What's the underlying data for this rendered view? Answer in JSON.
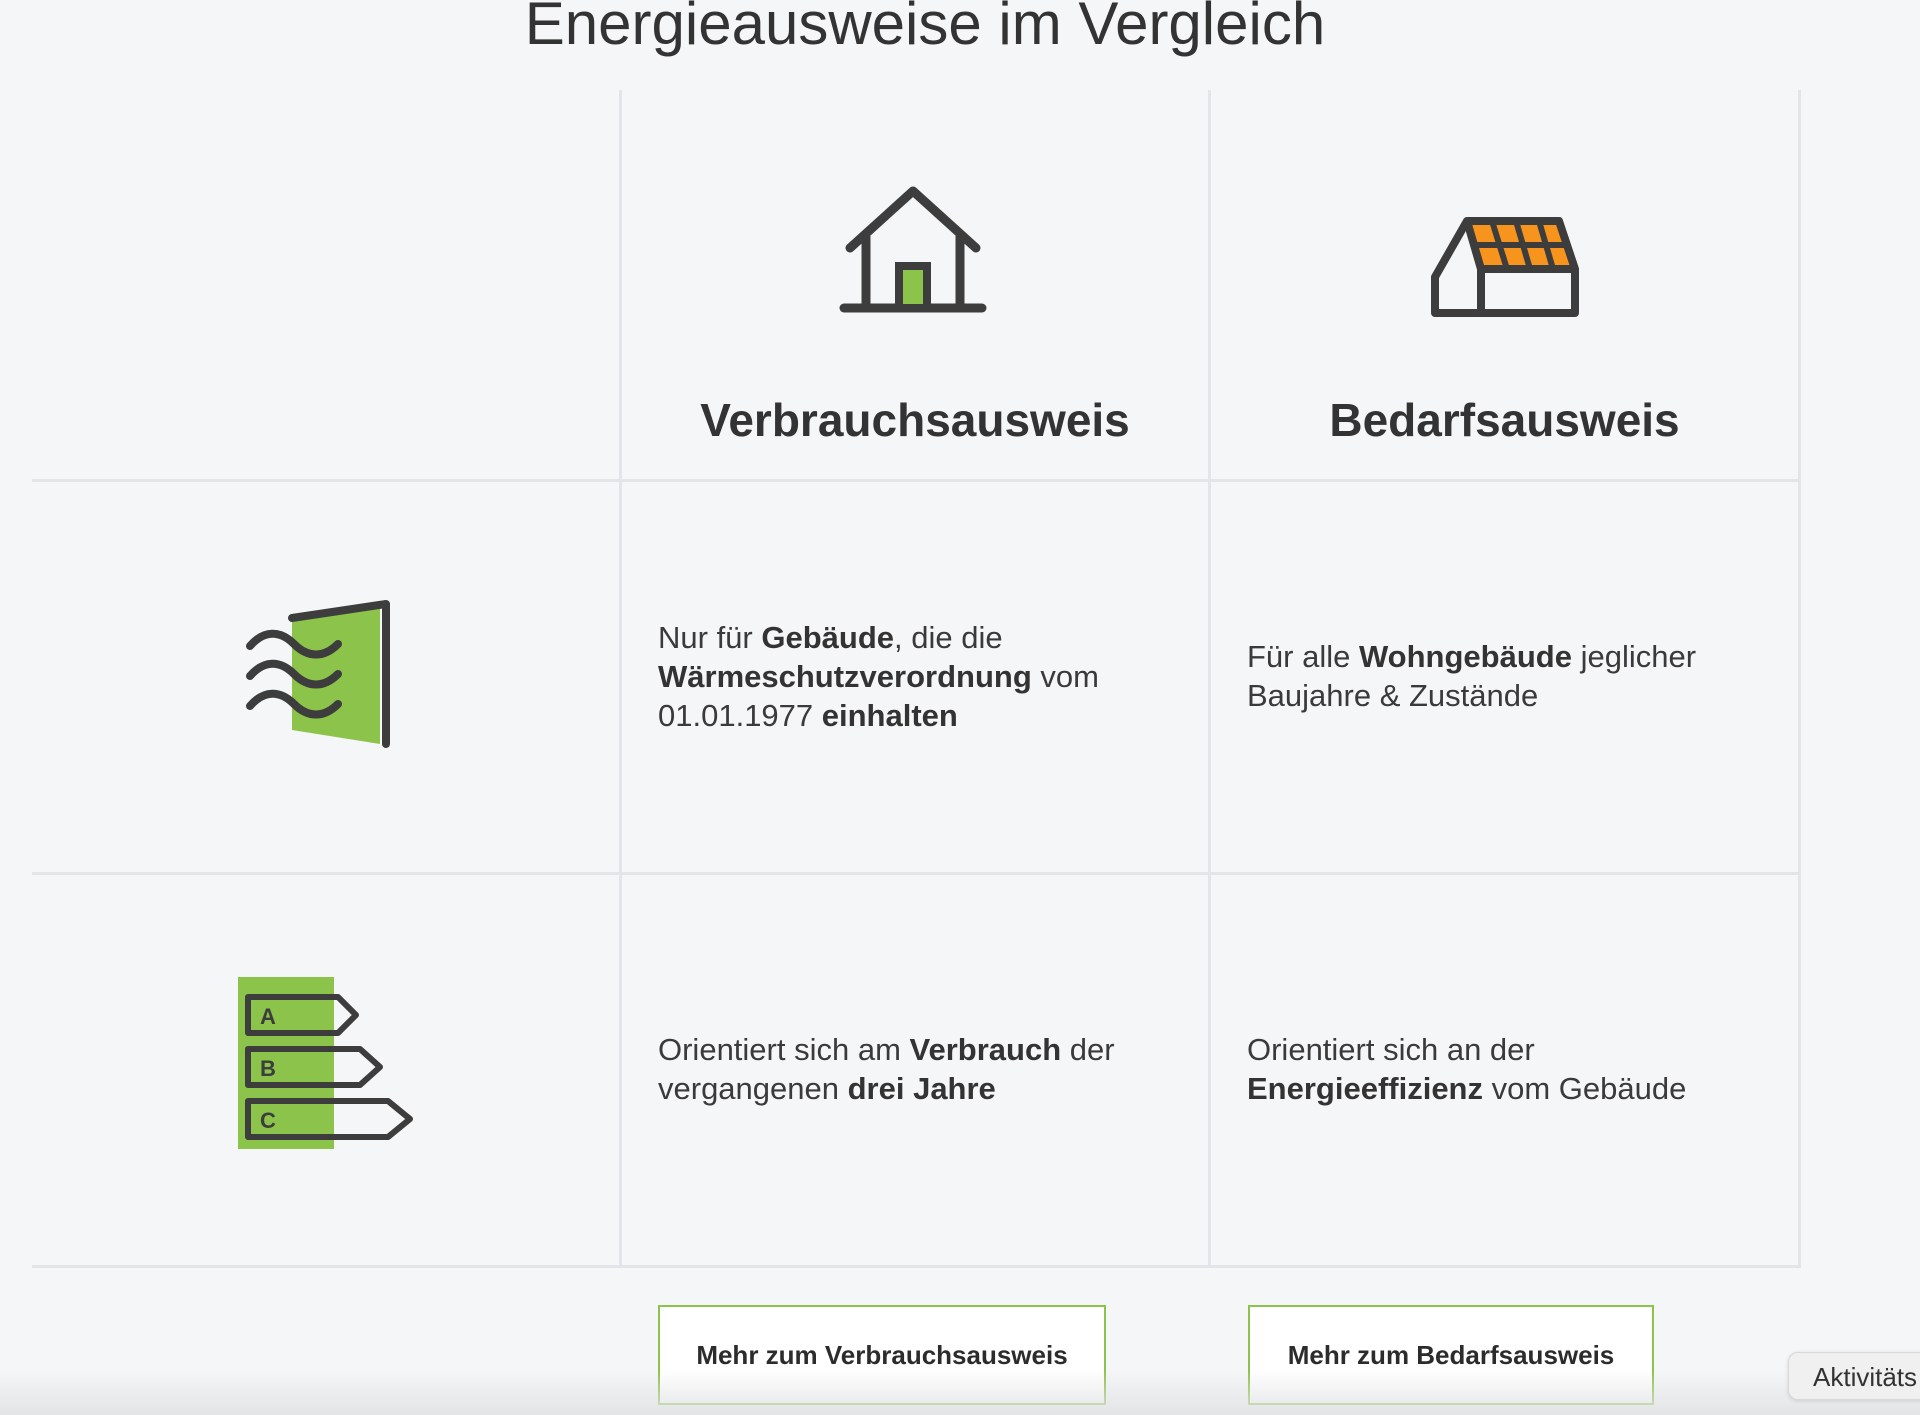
{
  "page": {
    "title": "Energieausweise im Vergleich"
  },
  "columns": [
    {
      "title": "Verbrauchsausweis",
      "icon": "house-icon",
      "accent": "#8cc34a"
    },
    {
      "title": "Bedarfsausweis",
      "icon": "solar-roof-house-icon",
      "accent": "#f7941d"
    }
  ],
  "rows": [
    {
      "icon": "insulated-wall-icon",
      "cells": [
        {
          "segments": [
            {
              "text": "Nur für ",
              "bold": false
            },
            {
              "text": "Gebäude",
              "bold": true
            },
            {
              "text": ", die die ",
              "bold": false
            },
            {
              "text": "Wärmeschutzverordnung",
              "bold": true
            },
            {
              "text": " vom 01.01.1977 ",
              "bold": false
            },
            {
              "text": "einhalten",
              "bold": true
            }
          ]
        },
        {
          "segments": [
            {
              "text": "Für alle ",
              "bold": false
            },
            {
              "text": "Wohngebäude",
              "bold": true
            },
            {
              "text": " jeglicher Baujahre & Zustände",
              "bold": false
            }
          ]
        }
      ]
    },
    {
      "icon": "energy-label-icon",
      "energy_classes": [
        "A",
        "B",
        "C"
      ],
      "cells": [
        {
          "segments": [
            {
              "text": "Orientiert sich am ",
              "bold": false
            },
            {
              "text": "Verbrauch",
              "bold": true
            },
            {
              "text": " der vergangenen ",
              "bold": false
            },
            {
              "text": "drei Jahre",
              "bold": true
            }
          ]
        },
        {
          "segments": [
            {
              "text": "Orientiert sich an der ",
              "bold": false
            },
            {
              "text": "Energieeffizienz",
              "bold": true
            },
            {
              "text": " vom Gebäude",
              "bold": false
            }
          ]
        }
      ]
    }
  ],
  "buttons": {
    "verbrauch_label": "Mehr zum Verbrauchsausweis",
    "bedarf_label": "Mehr zum Bedarfsausweis"
  },
  "activity_tab": {
    "label": "Aktivitäts"
  },
  "colors": {
    "background": "#f5f6f8",
    "green": "#8cc34a",
    "orange": "#f7941d",
    "icon_dark": "#3d3d3d",
    "grid": "#e3e5e8"
  }
}
